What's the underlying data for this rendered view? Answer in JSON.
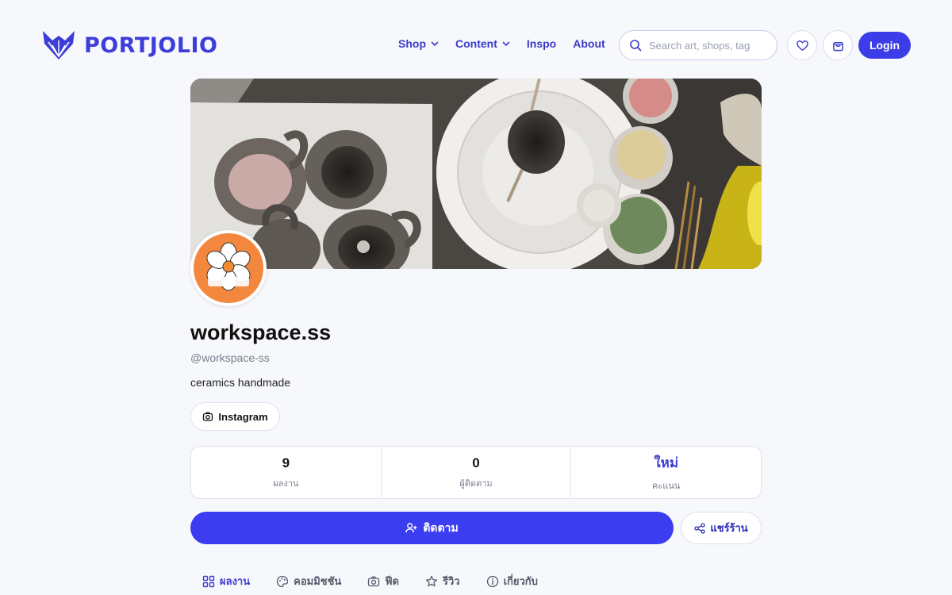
{
  "brand": {
    "name": "PORTJOLIO",
    "accent": "#3c3ce8"
  },
  "nav": {
    "links": [
      {
        "label": "Shop",
        "dropdown": true
      },
      {
        "label": "Content",
        "dropdown": true
      },
      {
        "label": "Inspo",
        "dropdown": false
      },
      {
        "label": "About",
        "dropdown": false
      }
    ],
    "search_placeholder": "Search art, shops, tag",
    "login_label": "Login"
  },
  "profile": {
    "name": "workspace.ss",
    "handle": "@workspace-ss",
    "bio": "ceramics handmade",
    "avatar_text": "workspace.ss",
    "social_label": "Instagram"
  },
  "stats": [
    {
      "value": "9",
      "label": "ผลงาน",
      "accent": false
    },
    {
      "value": "0",
      "label": "ผู้ติดตาม",
      "accent": false
    },
    {
      "value": "ใหม่",
      "label": "คะแนน",
      "accent": true
    }
  ],
  "actions": {
    "follow_label": "ติดตาม",
    "share_label": "แชร์ร้าน"
  },
  "tabs": [
    {
      "label": "ผลงาน",
      "icon": "grid-icon",
      "active": true
    },
    {
      "label": "คอมมิชชัน",
      "icon": "palette-icon",
      "active": false
    },
    {
      "label": "ฟีด",
      "icon": "camera-icon",
      "active": false
    },
    {
      "label": "รีวิว",
      "icon": "star-icon",
      "active": false
    },
    {
      "label": "เกี่ยวกับ",
      "icon": "info-icon",
      "active": false
    }
  ]
}
